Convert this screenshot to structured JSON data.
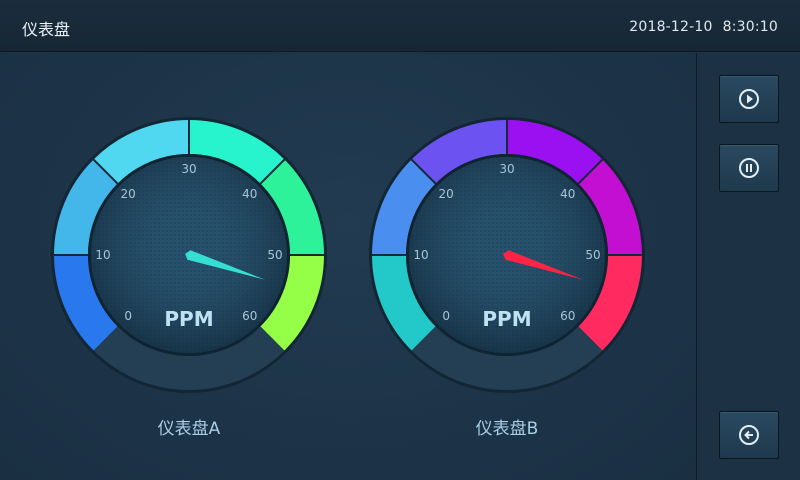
{
  "app": {
    "title": "仪表盘"
  },
  "status": {
    "date": "2018-12-10",
    "time": "8:30:10"
  },
  "gauges": [
    {
      "name": "仪表盘A",
      "unit": "PPM",
      "ticks": [
        "0",
        "10",
        "20",
        "30",
        "40",
        "50",
        "60"
      ],
      "value": 54,
      "needle_color": "#35e0d2",
      "colors": [
        "#2a78ee",
        "#43b6ea",
        "#4fd8ef",
        "#27f3cc",
        "#2ef29a",
        "#94ff46"
      ]
    },
    {
      "name": "仪表盘B",
      "unit": "PPM",
      "ticks": [
        "0",
        "10",
        "20",
        "30",
        "40",
        "50",
        "60"
      ],
      "value": 54,
      "needle_color": "#ff2346",
      "colors": [
        "#23c8c9",
        "#4a8ff0",
        "#6d52f2",
        "#9a10f0",
        "#c20fd2",
        "#ff2a60"
      ]
    }
  ],
  "controls": {
    "play": "play-icon",
    "pause": "pause-icon",
    "back": "back-arrow-icon"
  }
}
